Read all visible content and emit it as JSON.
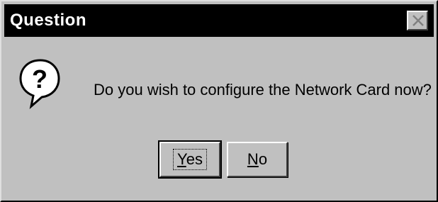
{
  "window": {
    "title": "Question",
    "close_icon": "close-icon"
  },
  "dialog": {
    "icon": "question-icon",
    "message": "Do you wish to configure the Network Card now?"
  },
  "buttons": {
    "yes_mnemonic": "Y",
    "yes_rest": "es",
    "no_mnemonic": "N",
    "no_rest": "o"
  },
  "colors": {
    "face": "#c0c0c0",
    "titlebar": "#000000",
    "title_text": "#ffffff"
  }
}
